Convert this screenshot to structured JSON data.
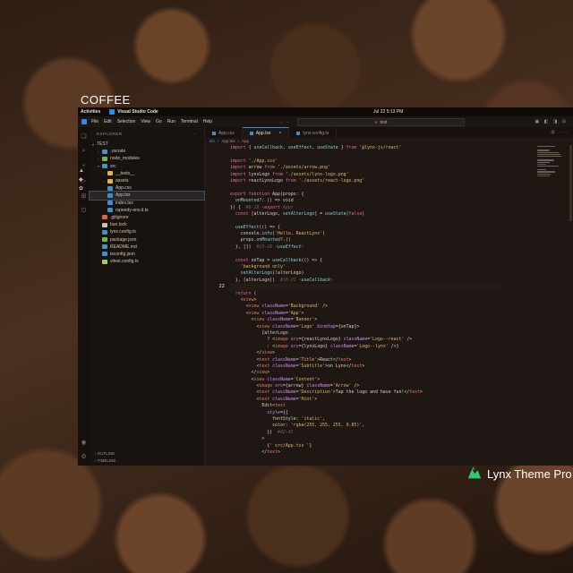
{
  "page": {
    "title": "COFFEE",
    "badge": "Lynx Theme Pro"
  },
  "topbar": {
    "activities": "Activities",
    "app_name": "Visual Studio Code",
    "clock": "Jul 22   5:13 PM"
  },
  "menubar": {
    "items": [
      "File",
      "Edit",
      "Selection",
      "View",
      "Go",
      "Run",
      "Terminal",
      "Help"
    ],
    "nav": "←  →",
    "search": "test"
  },
  "sidebar": {
    "header": "EXPLORER",
    "root": "TEST",
    "items": [
      {
        "label": ".vscode",
        "type": "folder",
        "depth": 1,
        "color": "#4a90c8"
      },
      {
        "label": "node_modules",
        "type": "folder",
        "depth": 1,
        "color": "#7bb34a"
      },
      {
        "label": "src",
        "type": "folder",
        "depth": 1,
        "color": "#4a90c8",
        "open": true
      },
      {
        "label": "__tests__",
        "type": "folder",
        "depth": 2,
        "color": "#e0b44a"
      },
      {
        "label": "assets",
        "type": "folder",
        "depth": 2,
        "color": "#e0b44a"
      },
      {
        "label": "App.css",
        "type": "file",
        "depth": 2,
        "color": "#3d8fd1"
      },
      {
        "label": "App.tsx",
        "type": "file",
        "depth": 2,
        "color": "#3d8fd1",
        "selected": true
      },
      {
        "label": "index.tsx",
        "type": "file",
        "depth": 2,
        "color": "#3d8fd1"
      },
      {
        "label": "rspeedy-env.d.ts",
        "type": "file",
        "depth": 2,
        "color": "#3d8fd1"
      },
      {
        "label": ".gitignore",
        "type": "file",
        "depth": 1,
        "color": "#e0623a"
      },
      {
        "label": "bun.lock",
        "type": "file",
        "depth": 1,
        "color": "#c9bfb5"
      },
      {
        "label": "lynx.config.ts",
        "type": "file",
        "depth": 1,
        "color": "#3d8fd1"
      },
      {
        "label": "package.json",
        "type": "file",
        "depth": 1,
        "color": "#7bb34a"
      },
      {
        "label": "README.md",
        "type": "file",
        "depth": 1,
        "color": "#4a90c8"
      },
      {
        "label": "tsconfig.json",
        "type": "file",
        "depth": 1,
        "color": "#3d8fd1"
      },
      {
        "label": "vitest.config.ts",
        "type": "file",
        "depth": 1,
        "color": "#9acd68"
      }
    ],
    "outline": "OUTLINE",
    "timeline": "TIMELINE"
  },
  "editor": {
    "tabs": [
      {
        "label": "App.css",
        "active": false
      },
      {
        "label": "App.tsx",
        "active": true
      },
      {
        "label": "lynx.config.ts",
        "active": false
      }
    ],
    "breadcrumb": [
      "src",
      "App.tsx",
      "App"
    ],
    "current_line_number": "22",
    "code_lines": [
      "import { useCallback, useEffect, useState } from '@lynx-js/react'",
      "",
      "import './App.css'",
      "import arrow from './assets/arrow.png'",
      "import lynxLogo from './assets/lynx-logo.png'",
      "import reactLynxLogo from './assets/react-logo.png'",
      "",
      "export function App(props: {",
      "  onMounted?: () => void",
      "}) {  #8-10 <export App>",
      "  const [alterLogo, setAlterLogo] = useState(false)",
      "",
      "  useEffect(() => {",
      "    console.info('Hello, ReactLynx')",
      "    props.onMounted?.()",
      "  }, [])  #13-16 <useEffect>",
      "",
      "  const onTap = useCallback(() => {",
      "    'background only'",
      "    setAlterLogo(!alterLogo)",
      "  }, [alterLogo])  #18-21 <useCallback>",
      "",
      "  return (",
      "    <view>",
      "      <view className='Background' />",
      "      <view className='App'>",
      "        <view className='Banner'>",
      "          <view className='Logo' bindtap={onTap}>",
      "            {alterLogo",
      "              ? <image src={reactLynxLogo} className='Logo--react' />",
      "              : <image src={lynxLogo} className='Logo--lynx' />}",
      "          </view>",
      "          <text className='Title'>React</text>",
      "          <text className='Subtitle'>on Lynx</text>",
      "        </view>",
      "        <view className='Content'>",
      "          <image src={arrow} className='Arrow' />",
      "          <text className='Description'>Tap the logo and have fun!</text>",
      "          <text className='Hint'>",
      "            Edit<text",
      "              style={{",
      "                fontStyle: 'italic',",
      "                color: 'rgba(255, 255, 255, 0.85)',",
      "              }}  #42-45",
      "            >",
      "              {' src/App.tsx '}",
      "            </text>"
    ]
  },
  "colors": {
    "accent": "#2f8ce6",
    "background": "#1a1410",
    "keyword": "#e06c9f",
    "string": "#e3b66b",
    "function": "#89d3d8",
    "tag": "#e07a5f",
    "comment": "#6b6158"
  }
}
